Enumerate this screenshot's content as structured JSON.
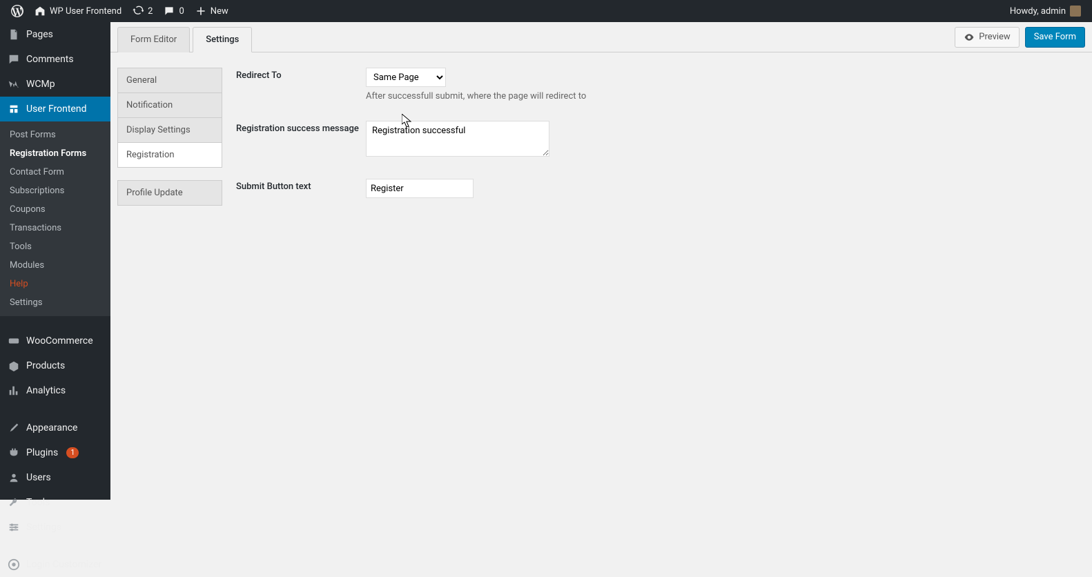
{
  "adminBar": {
    "siteName": "WP User Frontend",
    "updates": "2",
    "comments": "0",
    "new": "New",
    "howdy": "Howdy, admin"
  },
  "sidebar": {
    "pages": "Pages",
    "comments": "Comments",
    "wcmp": "WCMp",
    "userFrontend": "User Frontend",
    "subItems": {
      "postForms": "Post Forms",
      "registration": "Registration Forms",
      "contactForm": "Contact Form",
      "subscriptions": "Subscriptions",
      "coupons": "Coupons",
      "transactions": "Transactions",
      "tools": "Tools",
      "modules": "Modules",
      "help": "Help",
      "settings": "Settings"
    },
    "woocommerce": "WooCommerce",
    "products": "Products",
    "analytics": "Analytics",
    "appearance": "Appearance",
    "plugins": "Plugins",
    "pluginsCount": "1",
    "users": "Users",
    "tools": "Tools",
    "settings": "Settings",
    "loginCustomizer": "Login Customizer"
  },
  "tabs": {
    "formEditor": "Form Editor",
    "settings": "Settings"
  },
  "buttons": {
    "preview": "Preview",
    "save": "Save Form"
  },
  "settingsNav": {
    "general": "General",
    "notification": "Notification",
    "display": "Display Settings",
    "registration": "Registration",
    "profile": "Profile Update"
  },
  "form": {
    "redirect": {
      "label": "Redirect To",
      "value": "Same Page",
      "desc": "After successfull submit, where the page will redirect to"
    },
    "successMsg": {
      "label": "Registration success message",
      "value": "Registration successful"
    },
    "submitText": {
      "label": "Submit Button text",
      "value": "Register"
    }
  }
}
